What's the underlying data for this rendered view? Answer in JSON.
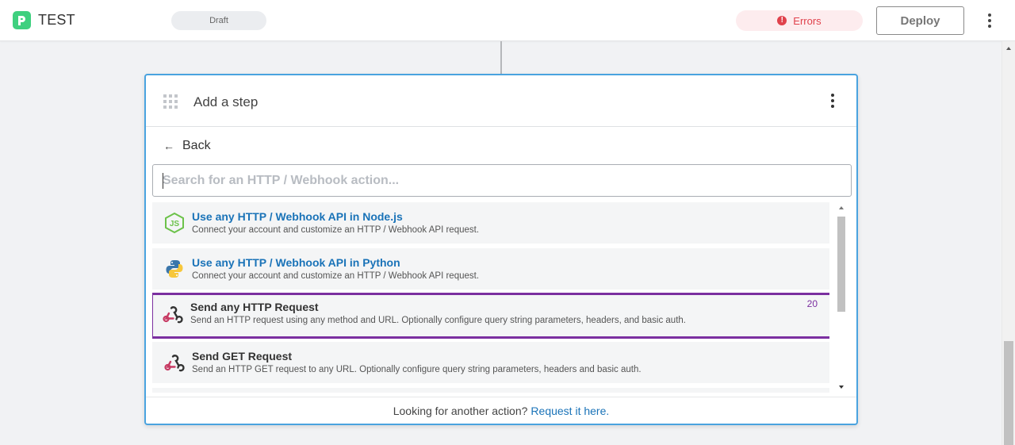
{
  "header": {
    "app_title": "TEST",
    "status_pill": "Draft",
    "errors_label": "Errors",
    "errors_icon": "!",
    "deploy_label": "Deploy"
  },
  "card": {
    "title": "Add a step",
    "back_arrow": "←",
    "back_label": "Back",
    "search_placeholder": "Search for an HTTP / Webhook action...",
    "search_value": "",
    "items": [
      {
        "icon": "nodejs-icon",
        "title": "Use any HTTP / Webhook API in Node.js",
        "description": "Connect your account and customize an HTTP / Webhook API request."
      },
      {
        "icon": "python-icon",
        "title": "Use any HTTP / Webhook API in Python",
        "description": "Connect your account and customize an HTTP / Webhook API request."
      },
      {
        "icon": "webhook-icon",
        "title": "Send any HTTP Request",
        "description": "Send an HTTP request using any method and URL. Optionally configure query string parameters, headers, and basic auth.",
        "badge": "20"
      },
      {
        "icon": "webhook-icon",
        "title": "Send GET Request",
        "description": "Send an HTTP GET request to any URL. Optionally configure query string parameters, headers and basic auth."
      }
    ],
    "footer_text": "Looking for another action?",
    "footer_link": "Request it here."
  },
  "colors": {
    "brand": "#3fd07f",
    "accent_border": "#4aa3df",
    "link": "#1a73b8",
    "highlight": "#7b2fa0",
    "error": "#e0414b"
  }
}
